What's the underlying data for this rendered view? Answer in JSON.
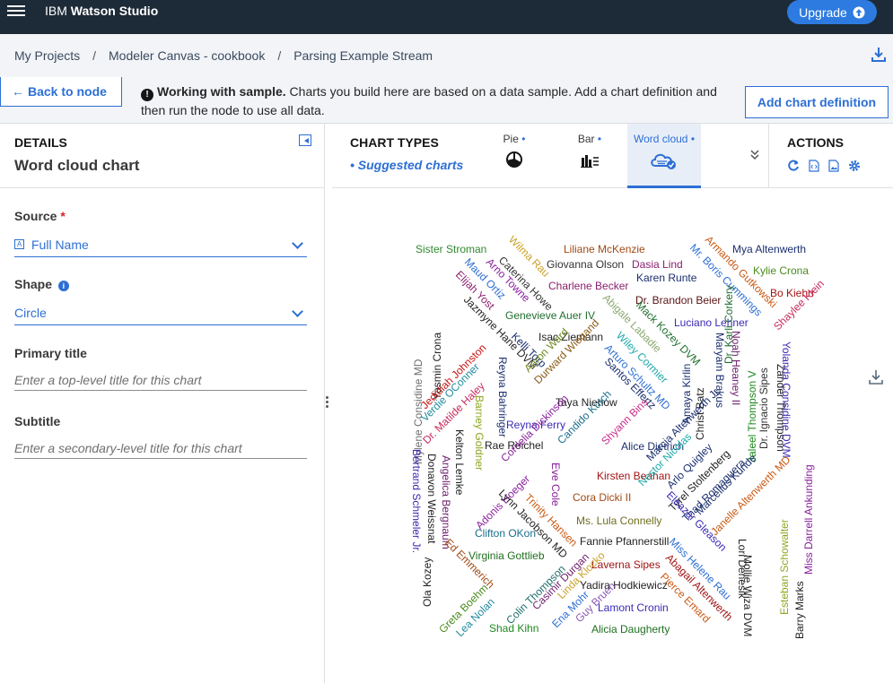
{
  "app": {
    "brand_light": "IBM",
    "brand_bold": "Watson Studio",
    "upgrade_label": "Upgrade"
  },
  "breadcrumb": {
    "items": [
      "My Projects",
      "Modeler Canvas - cookbook",
      "Parsing Example Stream"
    ],
    "separator": "/"
  },
  "sample_bar": {
    "back_label": "Back to node",
    "message_bold": "Working with sample.",
    "message_rest": "Charts you build here are based on a data sample. Add a chart definition and then run the node to use all data.",
    "add_chart_label": "Add chart definition"
  },
  "details": {
    "section_label": "DETAILS",
    "title": "Word cloud chart",
    "source_label": "Source",
    "source_required": "*",
    "source_value": "Full Name",
    "source_icon_glyph": "A",
    "shape_label": "Shape",
    "shape_value": "Circle",
    "primary_title_label": "Primary title",
    "primary_title_placeholder": "Enter a top-level title for this chart",
    "subtitle_label": "Subtitle",
    "subtitle_placeholder": "Enter a secondary-level title for this chart"
  },
  "chart_types": {
    "label": "CHART TYPES",
    "suggested": "• Suggested charts",
    "items": [
      {
        "label": "Pie",
        "icon": "pie-chart-icon"
      },
      {
        "label": "Bar",
        "icon": "bar-chart-icon"
      },
      {
        "label": "Word cloud",
        "icon": "word-cloud-icon",
        "selected": true
      }
    ],
    "dot": "•"
  },
  "actions": {
    "label": "ACTIONS",
    "icons": [
      "refresh-icon",
      "code-icon",
      "image-icon",
      "settings-icon"
    ]
  },
  "colors": {
    "topbar": "#1d2a37",
    "accent": "#2d6fd4",
    "upgrade": "#2d7be0",
    "subtle_bg": "#f2f4f8"
  },
  "word_cloud": {
    "words": [
      {
        "text": "Sister Stroman",
        "color": "#2f8a2f",
        "rot": 0
      },
      {
        "text": "Wilma Rau",
        "color": "#c9a227",
        "rot": 45
      },
      {
        "text": "Liliane McKenzie",
        "color": "#a14a14",
        "rot": 0
      },
      {
        "text": "Armando Gutkowski",
        "color": "#c95a14",
        "rot": 45
      },
      {
        "text": "Mya Altenwerth",
        "color": "#1a2e6e",
        "rot": 0
      },
      {
        "text": "Giovanna Olson",
        "color": "#333333",
        "rot": 0
      },
      {
        "text": "Dasia Lind",
        "color": "#8a1f6e",
        "rot": 0
      },
      {
        "text": "Mr. Boris Cummings",
        "color": "#2d6fd4",
        "rot": 45
      },
      {
        "text": "Kylie Crona",
        "color": "#4a8a1f",
        "rot": 0
      },
      {
        "text": "Caterina Howe",
        "color": "#333333",
        "rot": 45
      },
      {
        "text": "Karen Runte",
        "color": "#1a2e6e",
        "rot": 0
      },
      {
        "text": "Maud Ortiz",
        "color": "#2d6fd4",
        "rot": 45
      },
      {
        "text": "Arno Towne",
        "color": "#8a1f9e",
        "rot": 45
      },
      {
        "text": "Charlene Becker",
        "color": "#8a1f6e",
        "rot": 0
      },
      {
        "text": "Bo Kiehn",
        "color": "#a11414",
        "rot": 0
      },
      {
        "text": "Elijah Yost",
        "color": "#8a1f6e",
        "rot": 45
      },
      {
        "text": "Dr. Brandon Beier",
        "color": "#5a1414",
        "rot": 0
      },
      {
        "text": "Mylene Considine MD",
        "color": "#6f6f6f",
        "rot": -90
      },
      {
        "text": "Yasmin Crona",
        "color": "#222222",
        "rot": -90
      },
      {
        "text": "Jazmyne Hane DVM",
        "color": "#222222",
        "rot": 45
      },
      {
        "text": "Genevieve Auer IV",
        "color": "#1f6e2f",
        "rot": 0
      },
      {
        "text": "Abigale Labadie",
        "color": "#8aa86e",
        "rot": 45
      },
      {
        "text": "Mack Kozey DVM",
        "color": "#1f6e2f",
        "rot": 45
      },
      {
        "text": "Luciano Lehner",
        "color": "#3a2ab4",
        "rot": 0
      },
      {
        "text": "Shaylee Klein",
        "color": "#c92a5a",
        "rot": -45
      },
      {
        "text": "Kelli Torp",
        "color": "#1a2e6e",
        "rot": 45
      },
      {
        "text": "Isac Ziemann",
        "color": "#222222",
        "rot": 0
      },
      {
        "text": "Jedidiah Johnston",
        "color": "#c91414",
        "rot": -45
      },
      {
        "text": "Verdie OConner",
        "color": "#1f8a9e",
        "rot": -45
      },
      {
        "text": "Dr. Matilde Haley",
        "color": "#c92a5a",
        "rot": -45
      },
      {
        "text": "Reyna Bahringer",
        "color": "#1a2e6e",
        "rot": 90
      },
      {
        "text": "Aaron Ward",
        "color": "#6e8a1f",
        "rot": -45
      },
      {
        "text": "Durward Wiegand",
        "color": "#8a5a14",
        "rot": -45
      },
      {
        "text": "Wiley Cormier",
        "color": "#1fa8a8",
        "rot": 45
      },
      {
        "text": "Arturo Schultz MD",
        "color": "#2d6fd4",
        "rot": 45
      },
      {
        "text": "Noah Heaney II",
        "color": "#6e1f6e",
        "rot": 90
      },
      {
        "text": "Maryam Brakus",
        "color": "#1a2e6e",
        "rot": 90
      },
      {
        "text": "Dr. Karli Corkery",
        "color": "#1f6e2f",
        "rot": -90
      },
      {
        "text": "Jaleel Thompson V",
        "color": "#1f8a1f",
        "rot": -90
      },
      {
        "text": "Dr. Ignacio Sipes",
        "color": "#333333",
        "rot": -90
      },
      {
        "text": "Zander Thompson",
        "color": "#222222",
        "rot": 90
      },
      {
        "text": "Yolanda Considine DVM",
        "color": "#3a2ab4",
        "rot": 90
      },
      {
        "text": "Santos Effertz",
        "color": "#1a2e6e",
        "rot": 45
      },
      {
        "text": "Amaya Kirlin",
        "color": "#1a2e6e",
        "rot": -90
      },
      {
        "text": "Christ Batz",
        "color": "#222222",
        "rot": -90
      },
      {
        "text": "Taya Nienow",
        "color": "#222222",
        "rot": 0
      },
      {
        "text": "Barney Goldner",
        "color": "#8aa81f",
        "rot": 90
      },
      {
        "text": "Reyna Ferry",
        "color": "#3a2ab4",
        "rot": 0
      },
      {
        "text": "Shyann Bins",
        "color": "#c92a8a",
        "rot": -45
      },
      {
        "text": "Candido Kutch",
        "color": "#1a6e8a",
        "rot": -45
      },
      {
        "text": "Kelton Lemke",
        "color": "#222222",
        "rot": 90
      },
      {
        "text": "Rae Reichel",
        "color": "#222222",
        "rot": 0
      },
      {
        "text": "Cordelia Dickinson",
        "color": "#8a1f9e",
        "rot": -45
      },
      {
        "text": "Alice Dietrich",
        "color": "#1a2e6e",
        "rot": 0
      },
      {
        "text": "Marcia Altenwerth Jr.",
        "color": "#1a2e6e",
        "rot": -45
      },
      {
        "text": "Bertrand Schmeler Jr.",
        "color": "#3a2ab4",
        "rot": 90
      },
      {
        "text": "Donavon Weissnat",
        "color": "#222222",
        "rot": 90
      },
      {
        "text": "Angelica Bergnaum",
        "color": "#6e1f6e",
        "rot": 90
      },
      {
        "text": "Adonis Hoeger",
        "color": "#8a1f9e",
        "rot": -45
      },
      {
        "text": "Eve Cole",
        "color": "#8a1f9e",
        "rot": 90
      },
      {
        "text": "Kirsten Beahan",
        "color": "#a11414",
        "rot": 0
      },
      {
        "text": "Nestor Nicolas",
        "color": "#1fa8a8",
        "rot": -45
      },
      {
        "text": "Arlo Quigley",
        "color": "#1a2e6e",
        "rot": -45
      },
      {
        "text": "Tyrel Stoltenberg",
        "color": "#222222",
        "rot": -45
      },
      {
        "text": "Thad Romaguera",
        "color": "#1a2e6e",
        "rot": -45
      },
      {
        "text": "Marcellus Kunde",
        "color": "#1a2e6e",
        "rot": -45
      },
      {
        "text": "Janelle Altenwerth MD",
        "color": "#c95a14",
        "rot": -45
      },
      {
        "text": "Miss Darrell Ankunding",
        "color": "#8a1f9e",
        "rot": -90
      },
      {
        "text": "Lynn Jacobson MD",
        "color": "#222222",
        "rot": 45
      },
      {
        "text": "Trinity Hansen",
        "color": "#c95a14",
        "rot": 45
      },
      {
        "text": "Cora Dicki II",
        "color": "#a14a14",
        "rot": 0
      },
      {
        "text": "Eleazar Gleason",
        "color": "#3a2ab4",
        "rot": 45
      },
      {
        "text": "Ms. Lula Connelly",
        "color": "#6e6e1f",
        "rot": 0
      },
      {
        "text": "Clifton OKon",
        "color": "#1a6e8a",
        "rot": 0
      },
      {
        "text": "Fannie Pfannerstill",
        "color": "#222222",
        "rot": 0
      },
      {
        "text": "Miss Helene Rau",
        "color": "#2d6fd4",
        "rot": 45
      },
      {
        "text": "Esteban Schowalter",
        "color": "#8aa81f",
        "rot": -90
      },
      {
        "text": "Lori Denesik",
        "color": "#222222",
        "rot": 90
      },
      {
        "text": "Mollie Wiza DVM",
        "color": "#222222",
        "rot": 90
      },
      {
        "text": "Virginia Gottlieb",
        "color": "#1f6e1f",
        "rot": 0
      },
      {
        "text": "Ed Emmerich",
        "color": "#a14a14",
        "rot": 45
      },
      {
        "text": "Ola Kozey",
        "color": "#222222",
        "rot": -90
      },
      {
        "text": "Laverna Sipes",
        "color": "#a11414",
        "rot": 0
      },
      {
        "text": "Abagail Altenwerth",
        "color": "#a11414",
        "rot": 45
      },
      {
        "text": "Linda Klocko",
        "color": "#c9a227",
        "rot": -45
      },
      {
        "text": "Casimir Durgan",
        "color": "#6e1f6e",
        "rot": -45
      },
      {
        "text": "Colin Thompson",
        "color": "#1f6e6e",
        "rot": -45
      },
      {
        "text": "Yadira Hodkiewicz",
        "color": "#222222",
        "rot": 0
      },
      {
        "text": "Greta Boehm",
        "color": "#4a8a1f",
        "rot": -45
      },
      {
        "text": "Lea Nolan",
        "color": "#1f8a9e",
        "rot": -45
      },
      {
        "text": "Ena Mohr",
        "color": "#2d6fd4",
        "rot": -45
      },
      {
        "text": "Guy Bruen",
        "color": "#8a5ab4",
        "rot": -45
      },
      {
        "text": "Lamont Cronin",
        "color": "#3a2ab4",
        "rot": 0
      },
      {
        "text": "Pierce Emard",
        "color": "#c95a14",
        "rot": 45
      },
      {
        "text": "Barry Marks",
        "color": "#222222",
        "rot": -90
      },
      {
        "text": "Shad Kihn",
        "color": "#1f8a1f",
        "rot": 0
      },
      {
        "text": "Alicia Daugherty",
        "color": "#1f6e1f",
        "rot": 0
      }
    ]
  }
}
